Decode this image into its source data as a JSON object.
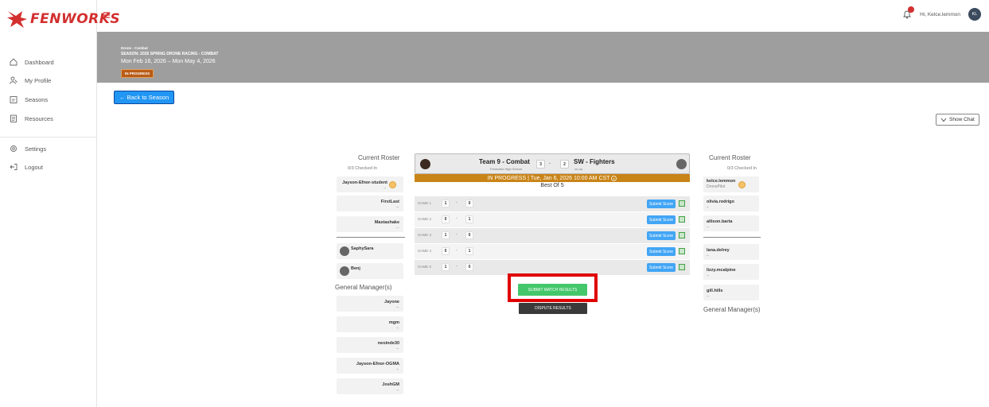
{
  "brand": {
    "name": "FENWORKS",
    "color": "#d32f2f"
  },
  "nav": [
    {
      "label": "Dashboard",
      "icon": "home-icon"
    },
    {
      "label": "My Profile",
      "icon": "user-icon"
    },
    {
      "label": "Seasons",
      "icon": "calendar-icon"
    },
    {
      "label": "Resources",
      "icon": "document-icon"
    },
    {
      "label": "Settings",
      "icon": "gear-icon"
    },
    {
      "label": "Logout",
      "icon": "logout-icon"
    }
  ],
  "header": {
    "greeting": "Hi, Kelce.lemmon",
    "avatar_initials": "KL"
  },
  "banner": {
    "line1": "Drone - Combat",
    "line2": "SEASON: 2026 SPRING DRONE RACING - COMBAT",
    "dates": "Mon Feb 16, 2026 – Mon May 4, 2026",
    "status": "IN PROGRESS"
  },
  "back_label": "← Back to Season",
  "show_chat_label": "Show Chat",
  "left_roster": {
    "title": "Current Roster",
    "checked": "0/3 Checked In",
    "players": [
      {
        "name": "Jayson-Efnor-student",
        "sub": "–"
      },
      {
        "name": "FirstLast",
        "sub": "–"
      },
      {
        "name": "Mastashake",
        "sub": "–"
      }
    ],
    "subs": [
      {
        "name": "SaphySara"
      },
      {
        "name": "Benj"
      }
    ],
    "gm_title": "General Manager(s)",
    "gms": [
      {
        "name": "Jayone",
        "sub": "–"
      },
      {
        "name": "mgm",
        "sub": "–"
      },
      {
        "name": "neoinde30",
        "sub": "–"
      },
      {
        "name": "Jayson-Efnor-OGMA",
        "sub": "–"
      },
      {
        "name": "JoshGM",
        "sub": "–"
      }
    ]
  },
  "right_roster": {
    "title": "Current Roster",
    "checked": "0/3 Checked In",
    "players": [
      {
        "name": "kelce.lemmon",
        "sub": "DronePilot"
      },
      {
        "name": "olivia.rodrigo",
        "sub": "–"
      },
      {
        "name": "allison.barta",
        "sub": "–"
      }
    ],
    "subs": [
      {
        "name": "lana.delrey",
        "sub": "–"
      },
      {
        "name": "lizzy.mcalpine",
        "sub": "–"
      },
      {
        "name": "gill.hills",
        "sub": "–"
      }
    ],
    "gm_title": "General Manager(s)"
  },
  "match": {
    "home": {
      "name": "Team 9 - Combat",
      "school": "Fenworks High School",
      "score": "3"
    },
    "away": {
      "name": "SW - Fighters",
      "school": "co-op",
      "score": "2"
    },
    "score_sep": "-",
    "status": "IN PROGRESS | Tue, Jan 6, 2026 10:00 AM CST",
    "best_of": "Best Of 5",
    "games": [
      {
        "label": "GAME 1",
        "home": "1",
        "away": "0"
      },
      {
        "label": "GAME 2",
        "home": "0",
        "away": "1"
      },
      {
        "label": "GAME 3",
        "home": "1",
        "away": "0"
      },
      {
        "label": "GAME 4",
        "home": "0",
        "away": "1"
      },
      {
        "label": "GAME 5",
        "home": "1",
        "away": "0"
      }
    ],
    "submit_score_label": "Submit Score",
    "submit_results_label": "SUBMIT MATCH RESULTS",
    "dispute_label": "DISPUTE RESULTS"
  }
}
